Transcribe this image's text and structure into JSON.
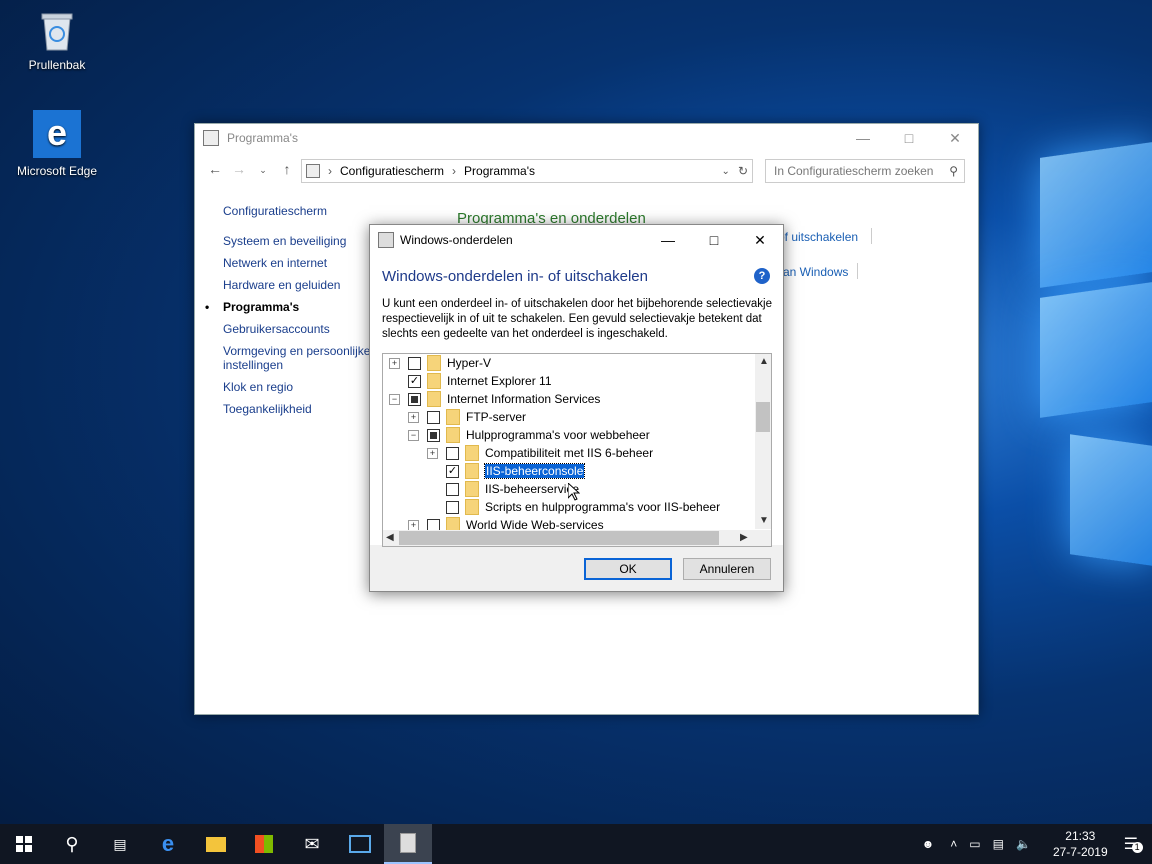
{
  "desktop": {
    "icons": [
      {
        "label": "Prullenbak",
        "icon": "recycle-bin-icon"
      },
      {
        "label": "Microsoft Edge",
        "icon": "edge-icon"
      }
    ]
  },
  "explorer": {
    "title": "Programma's",
    "breadcrumb": [
      "Configuratiescherm",
      "Programma's"
    ],
    "search_placeholder": "In Configuratiescherm zoeken",
    "nav": [
      "Configuratiescherm",
      "Systeem en beveiliging",
      "Netwerk en internet",
      "Hardware en geluiden",
      "Programma's",
      "Gebruikersaccounts",
      "Vormgeving en persoonlijke instellingen",
      "Klok en regio",
      "Toegankelijkheid"
    ],
    "section_heading": "Programma's en onderdelen",
    "link_partial_1": "of uitschakelen",
    "link_partial_2": "an Windows"
  },
  "dialog": {
    "title": "Windows-onderdelen",
    "heading": "Windows-onderdelen in- of uitschakelen",
    "description": "U kunt een onderdeel in- of uitschakelen door het bijbehorende selectievakje respectievelijk in of uit te schakelen. Een gevuld selectievakje betekent dat slechts een gedeelte van het onderdeel is ingeschakeld.",
    "tree": [
      {
        "label": "Hyper-V",
        "expander": "+",
        "state": "unchecked",
        "level": 0
      },
      {
        "label": "Internet Explorer 11",
        "expander": "",
        "state": "checked",
        "level": 0
      },
      {
        "label": "Internet Information Services",
        "expander": "-",
        "state": "partial",
        "level": 0
      },
      {
        "label": "FTP-server",
        "expander": "+",
        "state": "unchecked",
        "level": 1
      },
      {
        "label": "Hulpprogramma's voor webbeheer",
        "expander": "-",
        "state": "partial",
        "level": 1
      },
      {
        "label": "Compatibiliteit met IIS 6-beheer",
        "expander": "+",
        "state": "unchecked",
        "level": 2
      },
      {
        "label": "IIS-beheerconsole",
        "expander": "",
        "state": "checked",
        "level": 2,
        "selected": true
      },
      {
        "label": "IIS-beheerservice",
        "expander": "",
        "state": "unchecked",
        "level": 2
      },
      {
        "label": "Scripts en hulpprogramma's voor IIS-beheer",
        "expander": "",
        "state": "unchecked",
        "level": 2
      },
      {
        "label": "World Wide Web-services",
        "expander": "+",
        "state": "unchecked",
        "level": 1
      }
    ],
    "ok_label": "OK",
    "cancel_label": "Annuleren"
  },
  "taskbar": {
    "time": "21:33",
    "date": "27-7-2019",
    "notification_count": "1"
  }
}
